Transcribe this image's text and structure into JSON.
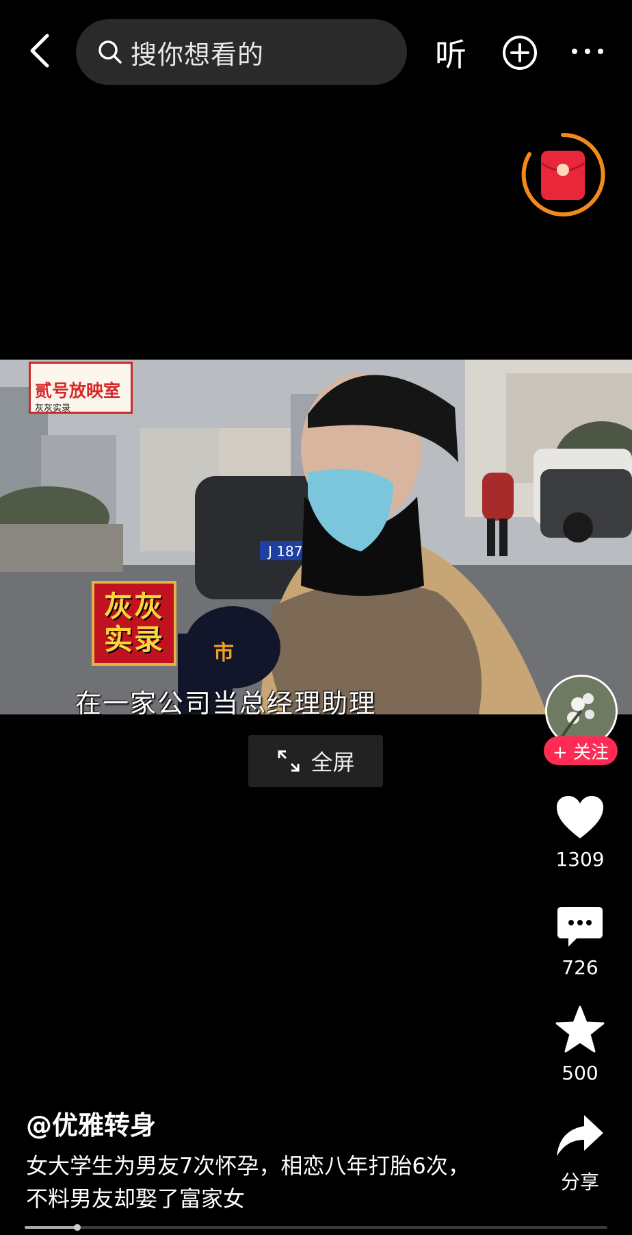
{
  "topbar": {
    "search_placeholder": "搜你想看的",
    "listen_label": "听"
  },
  "video": {
    "logo_title": "贰号放映室",
    "logo_subtitle": "灰灰实录",
    "stamp_line1": "灰灰",
    "stamp_line2": "实录",
    "subtitle": "在一家公司当总经理助理",
    "plate": "J 1878",
    "mic_text": "市"
  },
  "fullscreen": {
    "label": "全屏"
  },
  "rail": {
    "follow_label": "+ 关注",
    "likes": "1309",
    "comments": "726",
    "favorites": "500",
    "share_label": "分享"
  },
  "post": {
    "author": "@优雅转身",
    "caption": "女大学生为男友7次怀孕，相恋八年打胎6次，不料男友却娶了富家女"
  },
  "progress": {
    "fraction": 0.09
  },
  "colors": {
    "accent": "#fe2c55",
    "packet_ring": "#f28a1b",
    "packet": "#e8283a"
  },
  "icons": [
    "back-icon",
    "search-icon",
    "plus-circle-icon",
    "more-icon",
    "red-packet-icon",
    "fullscreen-icon",
    "heart-icon",
    "comment-icon",
    "star-icon",
    "share-icon"
  ]
}
